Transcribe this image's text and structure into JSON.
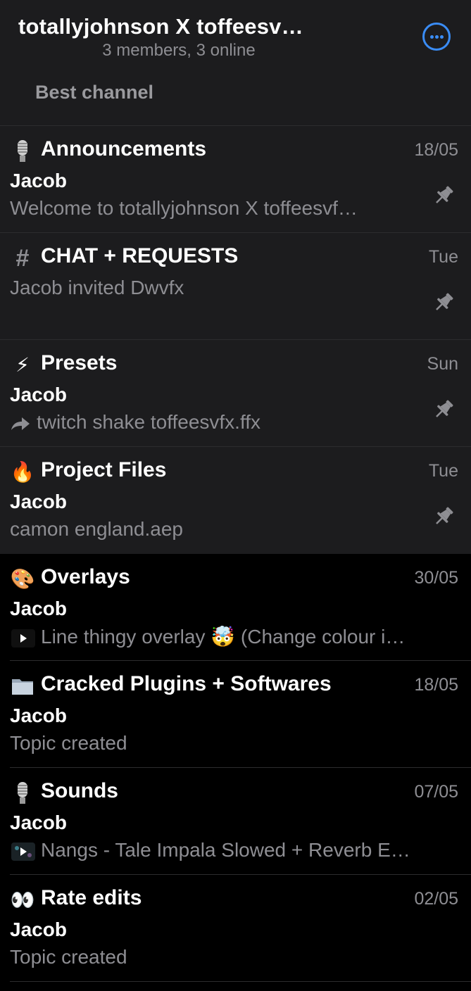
{
  "header": {
    "title": "totallyjohnson X toffeesv…",
    "subtitle": "3 members, 3 online",
    "description": "Best channel",
    "more_icon": "more-circle-icon",
    "accent": "#3a8cf5"
  },
  "topics": [
    {
      "emoji": "microphone-icon",
      "title": "Announcements",
      "date": "18/05",
      "sender": "Jacob",
      "preview": "Welcome to totallyjohnson X toffeesvf…",
      "pinned": true
    },
    {
      "emoji": "hash-icon",
      "title": "CHAT + REQUESTS",
      "date": "Tue",
      "sender": "",
      "preview": "Jacob invited Dwvfx",
      "pinned": true
    },
    {
      "emoji": "⚡",
      "title": "Presets",
      "date": "Sun",
      "sender": "Jacob",
      "preview": "twitch shake toffeesvfx.ffx",
      "preview_icon": "forward-arrow-icon",
      "pinned": true
    },
    {
      "emoji": "🔥",
      "title": "Project Files",
      "date": "Tue",
      "sender": "Jacob",
      "preview": "camon england.aep",
      "pinned": true
    },
    {
      "emoji": "🎨",
      "title": "Overlays",
      "date": "30/05",
      "sender": "Jacob",
      "preview": "Line thingy overlay",
      "preview_emoji": "🤯",
      "preview_tail": "(Change colour i…",
      "preview_icon": "play-icon",
      "pinned": false
    },
    {
      "emoji": "📁",
      "title": "Cracked Plugins + Softwares",
      "date": "18/05",
      "sender": "Jacob",
      "preview": "Topic created",
      "pinned": false
    },
    {
      "emoji": "microphone-icon",
      "title": "Sounds",
      "date": "07/05",
      "sender": "Jacob",
      "preview": "Nangs - Tale Impala Slowed + Reverb E…",
      "preview_icon": "video-thumbnail-icon",
      "pinned": false
    },
    {
      "emoji": "👀",
      "title": "Rate edits",
      "date": "02/05",
      "sender": "Jacob",
      "preview": "Topic created",
      "pinned": false
    }
  ],
  "icons": {
    "pin": "pin-icon"
  }
}
